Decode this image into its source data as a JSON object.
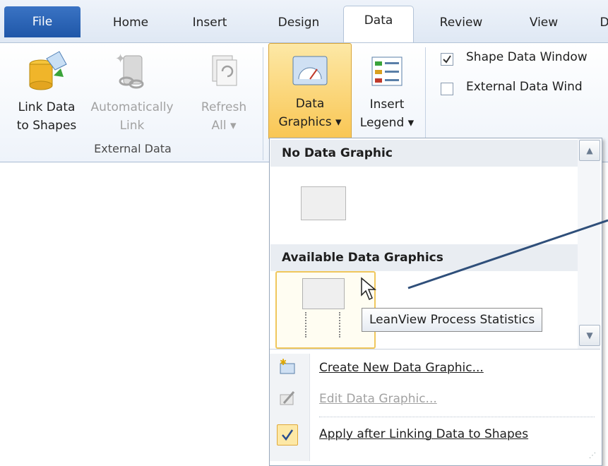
{
  "tabs": {
    "file": "File",
    "home": "Home",
    "insert": "Insert",
    "design": "Design",
    "data": "Data",
    "review": "Review",
    "view": "View",
    "extra": "D"
  },
  "ribbon": {
    "link_data": {
      "line1": "Link Data",
      "line2": "to Shapes"
    },
    "auto_link": {
      "line1": "Automatically",
      "line2": "Link"
    },
    "refresh_all": {
      "line1": "Refresh",
      "line2": "All"
    },
    "external_data_group": "External Data",
    "data_graphics": {
      "line1": "Data",
      "line2": "Graphics"
    },
    "insert_legend": {
      "line1": "Insert",
      "line2": "Legend"
    },
    "shape_data_window": "Shape Data Window",
    "external_data_window": "External Data Wind"
  },
  "dropdown": {
    "no_data_graphic_header": "No Data Graphic",
    "available_header": "Available Data Graphics",
    "tooltip": "LeanView Process Statistics",
    "create_new": "Create New Data Graphic...",
    "edit": "Edit Data Graphic...",
    "apply_after_linking": "Apply after Linking Data to Shapes"
  },
  "icons": [
    "database-link-icon",
    "chain-link-icon",
    "refresh-icon",
    "gauge-icon",
    "legend-icon",
    "checkbox-icon",
    "scroll-up-icon",
    "scroll-down-icon",
    "cursor-arrow-icon",
    "new-graphic-icon",
    "edit-graphic-icon",
    "checkmark-icon"
  ],
  "colors": {
    "accent_file": "#2a64b6",
    "highlight": "#f9c653",
    "callout_line": "#2f4f7a"
  }
}
